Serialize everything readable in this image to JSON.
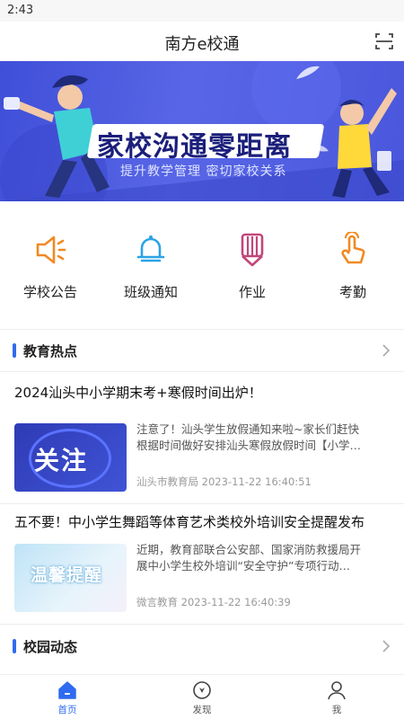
{
  "status_bar": {
    "time": "2:43"
  },
  "header": {
    "title": "南方e校通",
    "scan_icon": "scan-icon"
  },
  "banner": {
    "title": "家校沟通零距离",
    "subtitle": "提升教学管理 密切家校关系"
  },
  "quick_menu": [
    {
      "label": "学校公告",
      "icon": "megaphone-icon",
      "color": "#f08a24"
    },
    {
      "label": "班级通知",
      "icon": "bell-icon",
      "color": "#2ba3e6"
    },
    {
      "label": "作业",
      "icon": "pencil-icon",
      "color": "#c2467a"
    },
    {
      "label": "考勤",
      "icon": "hand-pointer-icon",
      "color": "#f08a24"
    }
  ],
  "sections": {
    "education_hot": {
      "title": "教育热点"
    },
    "campus_news": {
      "title": "校园动态"
    }
  },
  "articles": [
    {
      "title": "2024汕头中小学期末考+寒假时间出炉！",
      "thumb_text": "关注",
      "summary_line1": "注意了！汕头学生放假通知来啦~家长们赶快",
      "summary_line2": "根据时间做好安排汕头寒假放假时间【小学…",
      "meta": "汕头市教育局 2023-11-22 16:40:51"
    },
    {
      "title": "五不要！中小学生舞蹈等体育艺术类校外培训安全提醒发布",
      "thumb_text": "温馨提醒",
      "summary_line1": "近期，教育部联合公安部、国家消防救援局开",
      "summary_line2": "展中小学生校外培训“安全守护”专项行动…",
      "meta": "微言教育 2023-11-22 16:40:39"
    }
  ],
  "bottom_nav": [
    {
      "label": "首页",
      "icon": "home-icon",
      "active": true
    },
    {
      "label": "发现",
      "icon": "compass-icon",
      "active": false
    },
    {
      "label": "我",
      "icon": "user-icon",
      "active": false
    }
  ],
  "colors": {
    "accent": "#2f6bf0",
    "banner": "#4a57dd"
  }
}
